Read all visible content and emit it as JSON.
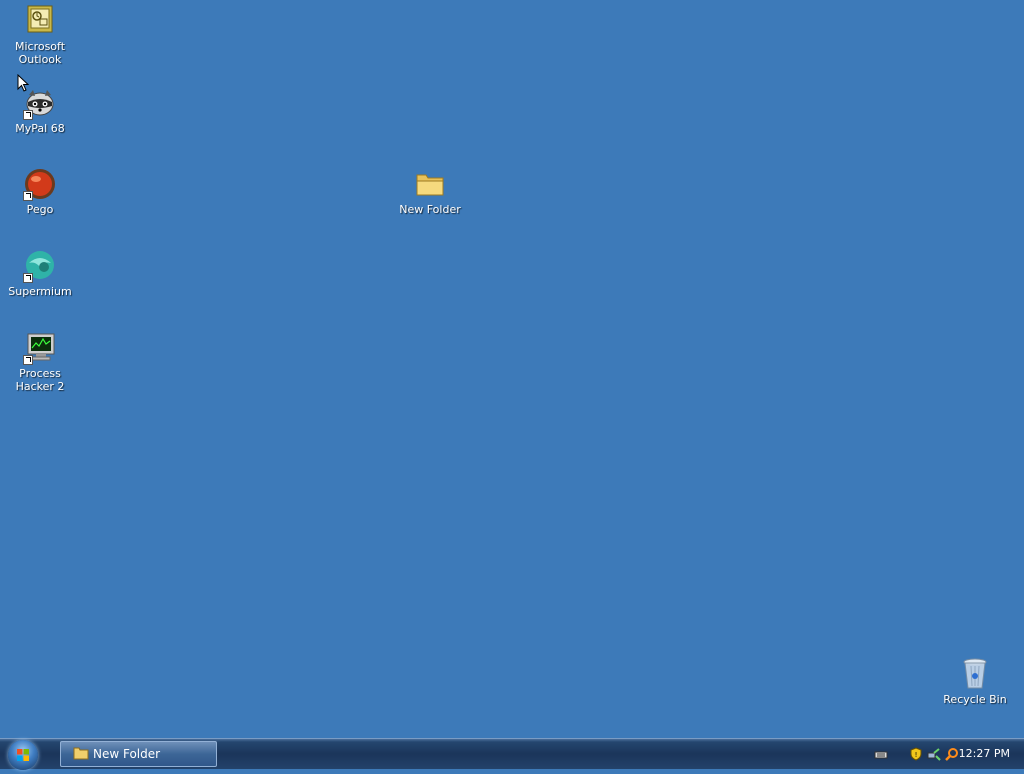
{
  "desktop": {
    "icons": [
      {
        "label_line1": "Microsoft",
        "label_line2": "Outlook",
        "icon": "outlook-icon"
      },
      {
        "label_line1": "MyPal 68",
        "label_line2": "",
        "icon": "raccoon-icon"
      },
      {
        "label_line1": "Pego",
        "label_line2": "",
        "icon": "pego-icon"
      },
      {
        "label_line1": "Supermium",
        "label_line2": "",
        "icon": "supermium-icon"
      },
      {
        "label_line1": "Process",
        "label_line2": "Hacker 2",
        "icon": "process-hacker-icon"
      },
      {
        "label_line1": "New Folder",
        "label_line2": "",
        "icon": "folder-icon"
      },
      {
        "label_line1": "Recycle Bin",
        "label_line2": "",
        "icon": "recycle-bin-icon"
      }
    ]
  },
  "taskbar": {
    "start_icon": "windows-start-orb",
    "task_button_label": "New Folder",
    "task_button_icon": "folder-icon",
    "tray_icons": [
      "keyboard-icon",
      "shield-icon",
      "network-icon",
      "search-icon"
    ],
    "clock": "12:27 PM"
  },
  "colors": {
    "desktop_background": "#3d7ab9",
    "taskbar": "#1b355a"
  }
}
